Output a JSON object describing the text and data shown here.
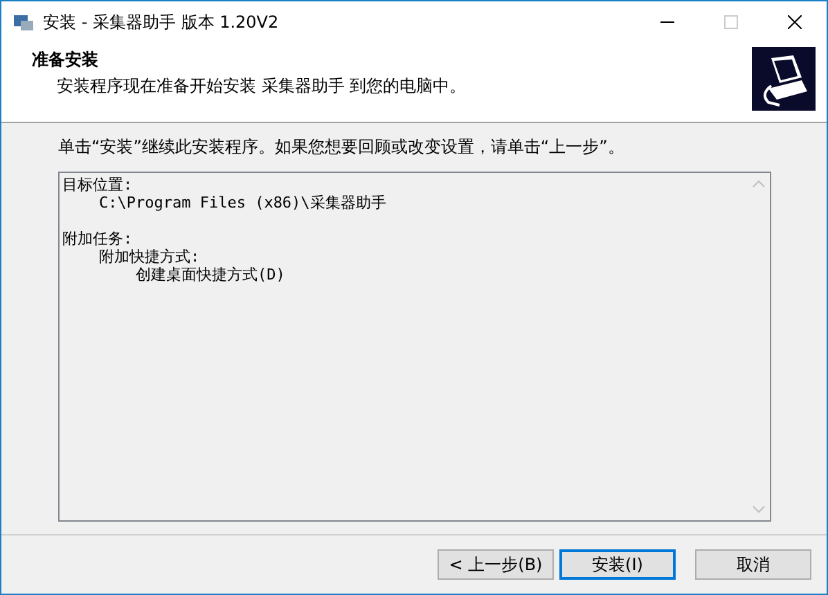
{
  "window": {
    "title": "安装 - 采集器助手 版本 1.20V2"
  },
  "header": {
    "title": "准备安装",
    "subtitle": "安装程序现在准备开始安装 采集器助手 到您的电脑中。"
  },
  "instruction": "单击“安装”继续此安装程序。如果您想要回顾或改变设置，请单击“上一步”。",
  "memo": [
    {
      "text": "目标位置:",
      "children": [
        {
          "text": "C:\\Program Files (x86)\\采集器助手"
        }
      ]
    },
    {
      "text": "附加任务:",
      "children": [
        {
          "text": "附加快捷方式:",
          "children": [
            {
              "text": "创建桌面快捷方式(D)"
            }
          ]
        }
      ]
    }
  ],
  "buttons": [
    {
      "label": "< 上一步(B)",
      "default": false
    },
    {
      "label": "安装(I)",
      "default": true
    },
    {
      "label": "取消",
      "default": false
    }
  ]
}
